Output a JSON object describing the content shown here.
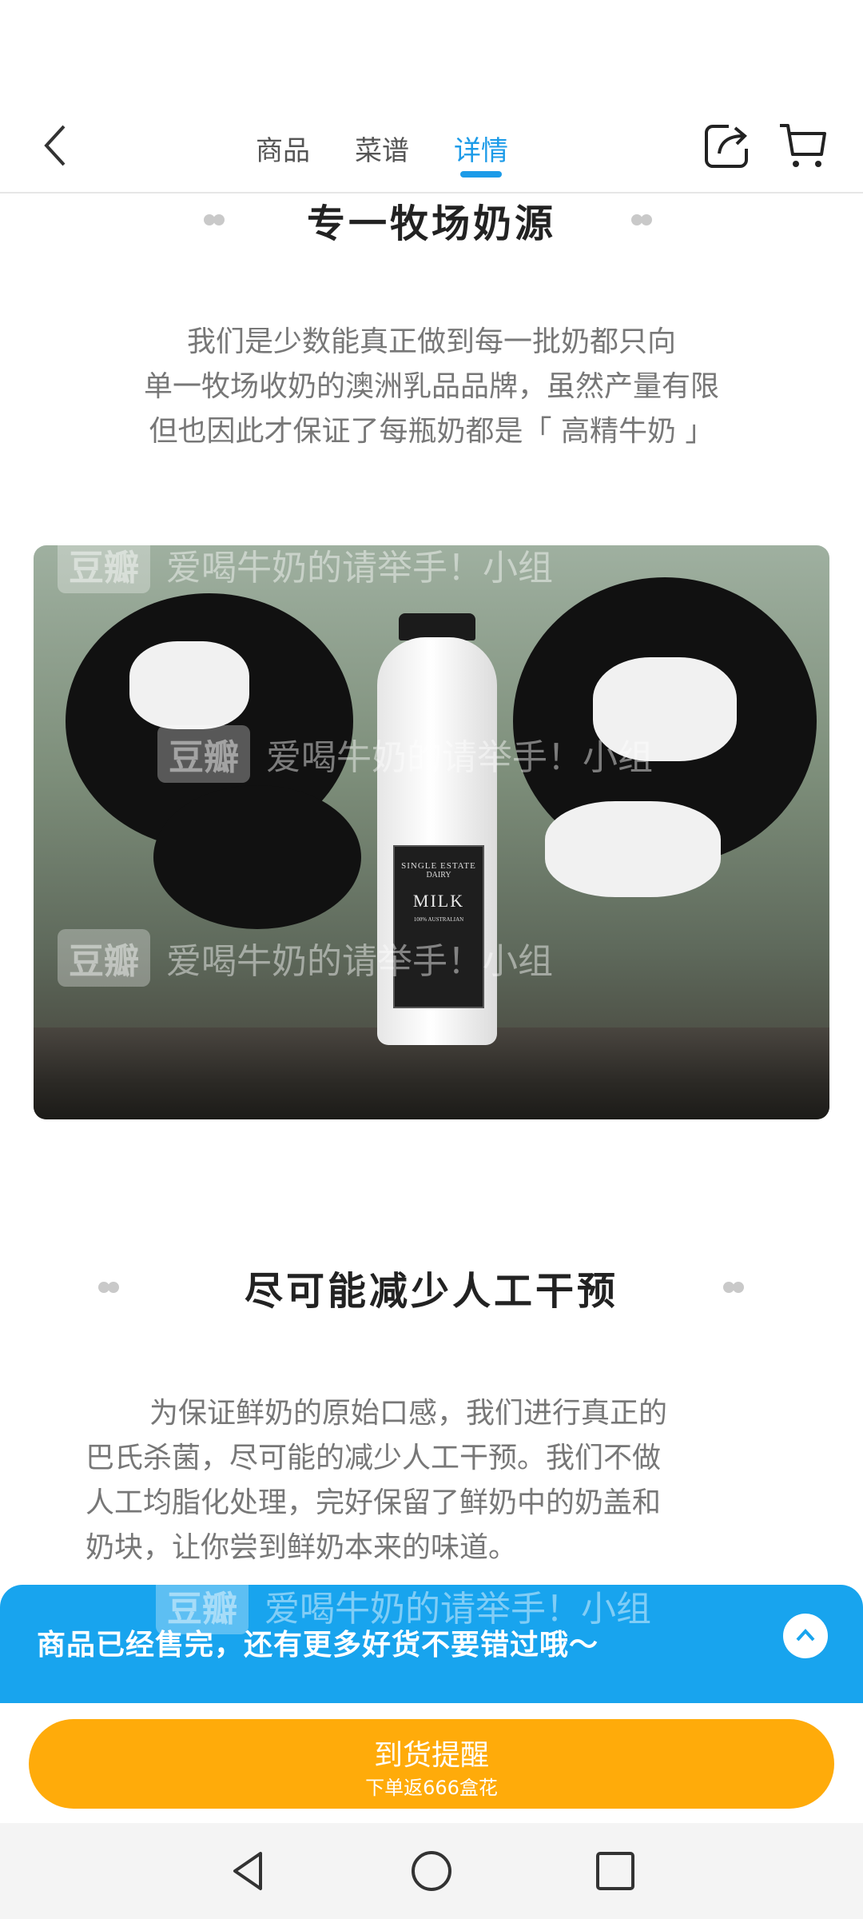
{
  "topnav": {
    "tabs": [
      {
        "label": "商品"
      },
      {
        "label": "菜谱"
      },
      {
        "label": "详情"
      }
    ],
    "active_tab": "详情"
  },
  "sections": [
    {
      "title": "专一牧场奶源",
      "paragraph_lines": [
        "我们是少数能真正做到每一批奶都只向",
        "单一牧场收奶的澳洲乳品品牌，虽然产量有限",
        "但也因此才保证了每瓶奶都是「 高精牛奶 」"
      ]
    },
    {
      "title": "尽可能减少人工干预",
      "paragraph_lines": [
        "为保证鲜奶的原始口感，我们进行真正的",
        "巴氏杀菌，尽可能的减少人工干预。我们不做",
        "人工均脂化处理，完好保留了鲜奶中的奶盖和",
        "奶块，让你尝到鲜奶本来的味道。"
      ]
    }
  ],
  "photo": {
    "bottle_label": [
      "SINGLE ESTATE",
      "DAIRY",
      "MILK",
      "100% AUSTRALIAN"
    ]
  },
  "watermark": {
    "logo": "豆瓣",
    "text": "爱喝牛奶的请举手！小组"
  },
  "banner": {
    "text": "商品已经售完，还有更多好货不要错过哦～"
  },
  "notify_button": {
    "label": "到货提醒",
    "sub": "下单返666盒花"
  },
  "colors": {
    "accent": "#1c9be8",
    "banner": "#18a4ee",
    "button": "#ffab0a"
  }
}
